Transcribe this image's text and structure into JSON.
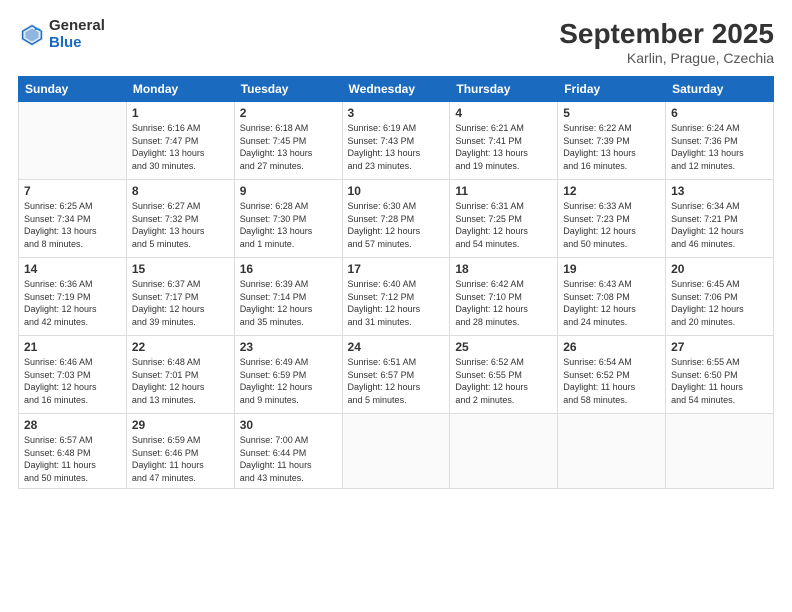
{
  "header": {
    "logo": {
      "general": "General",
      "blue": "Blue"
    },
    "title": "September 2025",
    "location": "Karlin, Prague, Czechia"
  },
  "calendar": {
    "days_of_week": [
      "Sunday",
      "Monday",
      "Tuesday",
      "Wednesday",
      "Thursday",
      "Friday",
      "Saturday"
    ],
    "weeks": [
      [
        {
          "num": "",
          "info": ""
        },
        {
          "num": "1",
          "info": "Sunrise: 6:16 AM\nSunset: 7:47 PM\nDaylight: 13 hours\nand 30 minutes."
        },
        {
          "num": "2",
          "info": "Sunrise: 6:18 AM\nSunset: 7:45 PM\nDaylight: 13 hours\nand 27 minutes."
        },
        {
          "num": "3",
          "info": "Sunrise: 6:19 AM\nSunset: 7:43 PM\nDaylight: 13 hours\nand 23 minutes."
        },
        {
          "num": "4",
          "info": "Sunrise: 6:21 AM\nSunset: 7:41 PM\nDaylight: 13 hours\nand 19 minutes."
        },
        {
          "num": "5",
          "info": "Sunrise: 6:22 AM\nSunset: 7:39 PM\nDaylight: 13 hours\nand 16 minutes."
        },
        {
          "num": "6",
          "info": "Sunrise: 6:24 AM\nSunset: 7:36 PM\nDaylight: 13 hours\nand 12 minutes."
        }
      ],
      [
        {
          "num": "7",
          "info": "Sunrise: 6:25 AM\nSunset: 7:34 PM\nDaylight: 13 hours\nand 8 minutes."
        },
        {
          "num": "8",
          "info": "Sunrise: 6:27 AM\nSunset: 7:32 PM\nDaylight: 13 hours\nand 5 minutes."
        },
        {
          "num": "9",
          "info": "Sunrise: 6:28 AM\nSunset: 7:30 PM\nDaylight: 13 hours\nand 1 minute."
        },
        {
          "num": "10",
          "info": "Sunrise: 6:30 AM\nSunset: 7:28 PM\nDaylight: 12 hours\nand 57 minutes."
        },
        {
          "num": "11",
          "info": "Sunrise: 6:31 AM\nSunset: 7:25 PM\nDaylight: 12 hours\nand 54 minutes."
        },
        {
          "num": "12",
          "info": "Sunrise: 6:33 AM\nSunset: 7:23 PM\nDaylight: 12 hours\nand 50 minutes."
        },
        {
          "num": "13",
          "info": "Sunrise: 6:34 AM\nSunset: 7:21 PM\nDaylight: 12 hours\nand 46 minutes."
        }
      ],
      [
        {
          "num": "14",
          "info": "Sunrise: 6:36 AM\nSunset: 7:19 PM\nDaylight: 12 hours\nand 42 minutes."
        },
        {
          "num": "15",
          "info": "Sunrise: 6:37 AM\nSunset: 7:17 PM\nDaylight: 12 hours\nand 39 minutes."
        },
        {
          "num": "16",
          "info": "Sunrise: 6:39 AM\nSunset: 7:14 PM\nDaylight: 12 hours\nand 35 minutes."
        },
        {
          "num": "17",
          "info": "Sunrise: 6:40 AM\nSunset: 7:12 PM\nDaylight: 12 hours\nand 31 minutes."
        },
        {
          "num": "18",
          "info": "Sunrise: 6:42 AM\nSunset: 7:10 PM\nDaylight: 12 hours\nand 28 minutes."
        },
        {
          "num": "19",
          "info": "Sunrise: 6:43 AM\nSunset: 7:08 PM\nDaylight: 12 hours\nand 24 minutes."
        },
        {
          "num": "20",
          "info": "Sunrise: 6:45 AM\nSunset: 7:06 PM\nDaylight: 12 hours\nand 20 minutes."
        }
      ],
      [
        {
          "num": "21",
          "info": "Sunrise: 6:46 AM\nSunset: 7:03 PM\nDaylight: 12 hours\nand 16 minutes."
        },
        {
          "num": "22",
          "info": "Sunrise: 6:48 AM\nSunset: 7:01 PM\nDaylight: 12 hours\nand 13 minutes."
        },
        {
          "num": "23",
          "info": "Sunrise: 6:49 AM\nSunset: 6:59 PM\nDaylight: 12 hours\nand 9 minutes."
        },
        {
          "num": "24",
          "info": "Sunrise: 6:51 AM\nSunset: 6:57 PM\nDaylight: 12 hours\nand 5 minutes."
        },
        {
          "num": "25",
          "info": "Sunrise: 6:52 AM\nSunset: 6:55 PM\nDaylight: 12 hours\nand 2 minutes."
        },
        {
          "num": "26",
          "info": "Sunrise: 6:54 AM\nSunset: 6:52 PM\nDaylight: 11 hours\nand 58 minutes."
        },
        {
          "num": "27",
          "info": "Sunrise: 6:55 AM\nSunset: 6:50 PM\nDaylight: 11 hours\nand 54 minutes."
        }
      ],
      [
        {
          "num": "28",
          "info": "Sunrise: 6:57 AM\nSunset: 6:48 PM\nDaylight: 11 hours\nand 50 minutes."
        },
        {
          "num": "29",
          "info": "Sunrise: 6:59 AM\nSunset: 6:46 PM\nDaylight: 11 hours\nand 47 minutes."
        },
        {
          "num": "30",
          "info": "Sunrise: 7:00 AM\nSunset: 6:44 PM\nDaylight: 11 hours\nand 43 minutes."
        },
        {
          "num": "",
          "info": ""
        },
        {
          "num": "",
          "info": ""
        },
        {
          "num": "",
          "info": ""
        },
        {
          "num": "",
          "info": ""
        }
      ]
    ]
  }
}
